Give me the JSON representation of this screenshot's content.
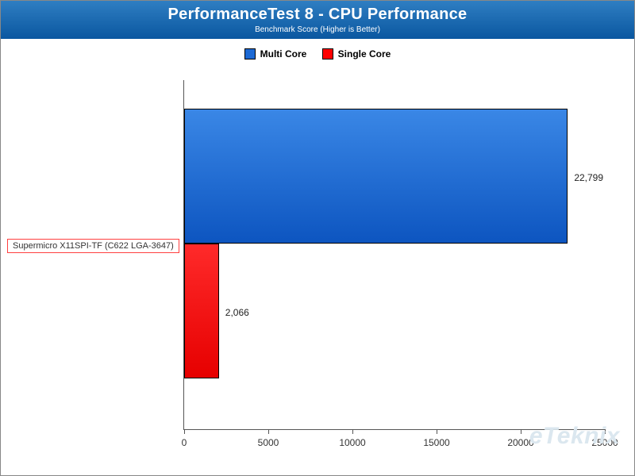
{
  "chart_data": {
    "type": "bar",
    "orientation": "horizontal",
    "title": "PerformanceTest 8 - CPU Performance",
    "subtitle": "Benchmark Score (Higher is Better)",
    "categories": [
      "Supermicro X11SPI-TF (C622 LGA-3647)"
    ],
    "series": [
      {
        "name": "Multi Core",
        "values": [
          22799
        ],
        "value_labels": [
          "22,799"
        ],
        "color": "#1c69d4"
      },
      {
        "name": "Single Core",
        "values": [
          2066
        ],
        "value_labels": [
          "2,066"
        ],
        "color": "#ff0000"
      }
    ],
    "xlabel": "",
    "ylabel": "",
    "xlim": [
      0,
      25000
    ],
    "xticks": [
      0,
      5000,
      10000,
      15000,
      20000,
      25000
    ],
    "legend_position": "top",
    "grid": false
  },
  "watermark": "eTeknix"
}
